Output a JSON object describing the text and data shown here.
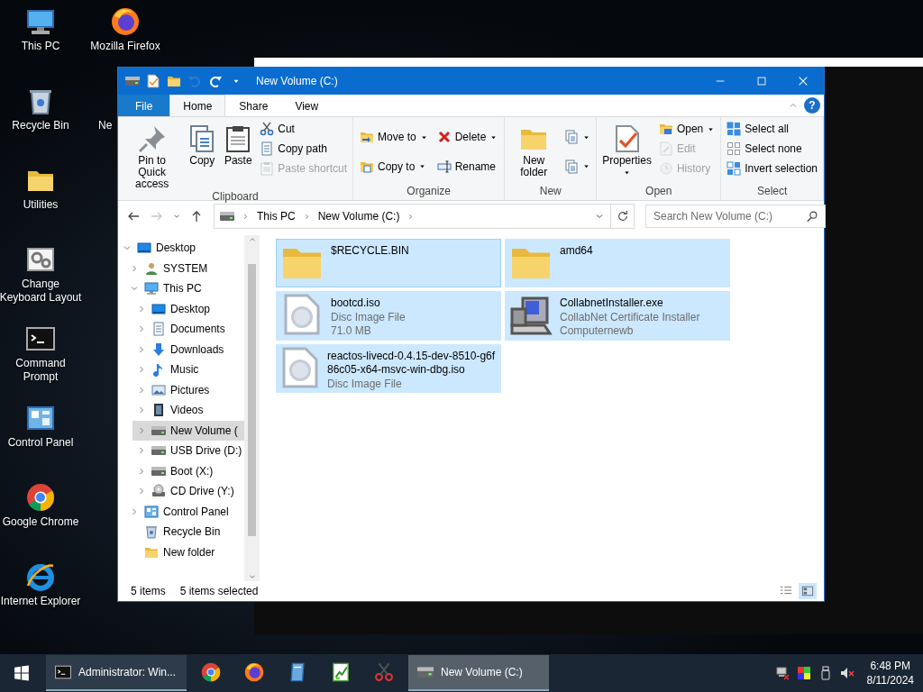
{
  "desktop_icons": [
    {
      "label": "This PC",
      "kind": "computer"
    },
    {
      "label": "Recycle Bin",
      "kind": "recycle-bin"
    },
    {
      "label": "Utilities",
      "kind": "folder"
    },
    {
      "label": "Change Keyboard Layout",
      "kind": "gears"
    },
    {
      "label": "Command Prompt",
      "kind": "terminal"
    },
    {
      "label": "Control Panel",
      "kind": "control-panel"
    },
    {
      "label": "Google Chrome",
      "kind": "chrome"
    },
    {
      "label": "Internet Explorer",
      "kind": "ie"
    },
    {
      "label": "Mozilla Firefox",
      "kind": "firefox"
    },
    {
      "label": "Ne",
      "kind": "partial"
    }
  ],
  "window": {
    "title": "New Volume (C:)",
    "quick_access": [
      {
        "kind": "drive",
        "disabled": false
      },
      {
        "kind": "check",
        "disabled": false
      },
      {
        "kind": "folder",
        "disabled": false
      },
      {
        "kind": "undo",
        "disabled": true
      },
      {
        "kind": "redo",
        "disabled": false
      },
      {
        "kind": "caret",
        "disabled": false
      }
    ],
    "tabs": [
      {
        "label": "File",
        "kind": "file",
        "selected": false
      },
      {
        "label": "Home",
        "kind": "tab",
        "selected": true
      },
      {
        "label": "Share",
        "kind": "tab",
        "selected": false
      },
      {
        "label": "View",
        "kind": "tab",
        "selected": false
      }
    ],
    "help": "?",
    "ribbon": [
      {
        "label": "Clipboard",
        "columns": [
          [
            {
              "label": "Pin to Quick access",
              "kind": "large",
              "disabled": false,
              "dropdown": false
            }
          ],
          [
            {
              "label": "Copy",
              "kind": "large",
              "disabled": false,
              "dropdown": false
            }
          ],
          [
            {
              "label": "Paste",
              "kind": "large",
              "disabled": false,
              "dropdown": false
            }
          ],
          [
            {
              "label": "Cut",
              "kind": "small",
              "disabled": false,
              "dropdown": false
            },
            {
              "label": "Copy path",
              "kind": "small",
              "disabled": false,
              "dropdown": false
            },
            {
              "label": "Paste shortcut",
              "kind": "small",
              "disabled": true,
              "dropdown": false
            }
          ]
        ]
      },
      {
        "label": "Organize",
        "columns": [
          [
            {
              "label": "Move to",
              "kind": "medium",
              "disabled": false,
              "dropdown": true
            },
            {
              "label": "Copy to",
              "kind": "medium",
              "disabled": false,
              "dropdown": true
            }
          ],
          [
            {
              "label": "Delete",
              "kind": "medium",
              "disabled": false,
              "dropdown": true
            },
            {
              "label": "Rename",
              "kind": "medium",
              "disabled": false,
              "dropdown": false
            }
          ]
        ]
      },
      {
        "label": "New",
        "columns": [
          [
            {
              "label": "New folder",
              "kind": "large",
              "disabled": false,
              "dropdown": false
            }
          ],
          [
            {
              "kind": "small",
              "disabled": false,
              "dropdown": true
            },
            {
              "kind": "small",
              "disabled": false,
              "dropdown": true
            }
          ]
        ]
      },
      {
        "label": "Open",
        "columns": [
          [
            {
              "label": "Properties",
              "kind": "large",
              "disabled": false,
              "dropdown": true
            }
          ],
          [
            {
              "label": "Open",
              "kind": "small",
              "disabled": false,
              "dropdown": true
            },
            {
              "label": "Edit",
              "kind": "small",
              "disabled": true,
              "dropdown": false
            },
            {
              "label": "History",
              "kind": "small",
              "disabled": true,
              "dropdown": false
            }
          ]
        ]
      },
      {
        "label": "Select",
        "columns": [
          [
            {
              "label": "Select all",
              "kind": "small",
              "disabled": false,
              "dropdown": false
            },
            {
              "label": "Select none",
              "kind": "small",
              "disabled": false,
              "dropdown": false
            },
            {
              "label": "Invert selection",
              "kind": "small",
              "disabled": false,
              "dropdown": false
            }
          ]
        ]
      }
    ],
    "nav_buttons": [
      {
        "kind": "back",
        "disabled": false
      },
      {
        "kind": "forward",
        "disabled": true
      },
      {
        "kind": "recent",
        "disabled": false
      },
      {
        "kind": "up",
        "disabled": false
      }
    ],
    "breadcrumb": [
      "This PC",
      "New Volume (C:)"
    ],
    "search": {
      "placeholder": "Search New Volume (C:)"
    },
    "nav_tree": [
      {
        "label": "Desktop",
        "kind": "desktop",
        "expanded": true,
        "selected": false,
        "children": [
          {
            "label": "SYSTEM",
            "kind": "user",
            "expanded": false,
            "selected": false
          },
          {
            "label": "This PC",
            "kind": "computer",
            "expanded": true,
            "selected": false,
            "children": [
              {
                "label": "Desktop",
                "kind": "desktop",
                "expanded": false,
                "selected": false
              },
              {
                "label": "Documents",
                "kind": "document",
                "expanded": false,
                "selected": false
              },
              {
                "label": "Downloads",
                "kind": "download",
                "expanded": false,
                "selected": false
              },
              {
                "label": "Music",
                "kind": "music",
                "expanded": false,
                "selected": false
              },
              {
                "label": "Pictures",
                "kind": "picture",
                "expanded": false,
                "selected": false
              },
              {
                "label": "Videos",
                "kind": "film",
                "expanded": false,
                "selected": false
              },
              {
                "label": "New Volume (",
                "kind": "drive",
                "expanded": false,
                "selected": true
              },
              {
                "label": "USB Drive (D:)",
                "kind": "drive",
                "expanded": false,
                "selected": false
              },
              {
                "label": "Boot (X:)",
                "kind": "drive",
                "expanded": false,
                "selected": false
              },
              {
                "label": "CD Drive (Y:)",
                "kind": "cd",
                "expanded": false,
                "selected": false
              }
            ]
          },
          {
            "label": "Control Panel",
            "kind": "control-panel",
            "expanded": false,
            "selected": false
          },
          {
            "label": "Recycle Bin",
            "kind": "recycle-bin",
            "selected": false
          },
          {
            "label": "New folder",
            "kind": "folder",
            "selected": false
          }
        ]
      }
    ],
    "files": [
      {
        "name": "$RECYCLE.BIN",
        "kind": "folder",
        "selected": true
      },
      {
        "name": "amd64",
        "kind": "folder",
        "selected": true
      },
      {
        "name": "bootcd.iso",
        "kind": "disc",
        "selected": true,
        "details": [
          "Disc Image File",
          "71.0 MB"
        ]
      },
      {
        "name": "CollabnetInstaller.exe",
        "kind": "installer",
        "selected": true,
        "details": [
          "CollabNet Certificate Installer",
          "Computernewb"
        ]
      },
      {
        "name": "reactos-livecd-0.4.15-dev-8510-g6f86c05-x64-msvc-win-dbg.iso",
        "kind": "disc",
        "selected": true,
        "details": [
          "Disc Image File"
        ]
      }
    ],
    "status_bar": {
      "count": "5 items",
      "selection": "5 items selected",
      "views": [
        {
          "kind": "details",
          "selected": false
        },
        {
          "kind": "tiles",
          "selected": true
        }
      ]
    }
  },
  "taskbar": {
    "items": [
      {
        "kind": "terminal",
        "label": "Administrator: Win...",
        "active": false
      },
      {
        "kind": "chrome",
        "active": false
      },
      {
        "kind": "firefox",
        "active": false
      },
      {
        "kind": "notepad",
        "active": false
      },
      {
        "kind": "chart",
        "active": false
      },
      {
        "kind": "snip",
        "active": false
      },
      {
        "kind": "drive",
        "label": "New Volume (C:)",
        "active": true
      }
    ],
    "time": "6:48 PM",
    "date": "8/11/2024"
  }
}
